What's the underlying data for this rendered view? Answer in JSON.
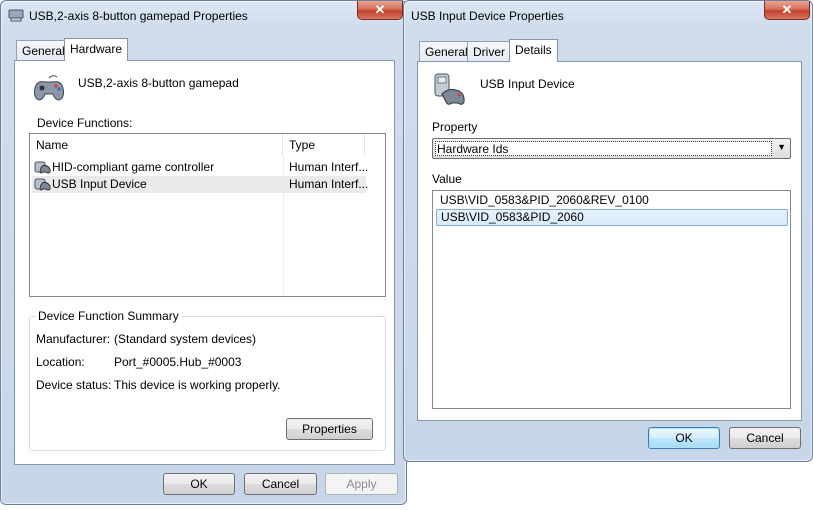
{
  "left_window": {
    "title": "USB,2-axis 8-button gamepad Properties",
    "close_label": "✕",
    "tabs": [
      "General",
      "Hardware"
    ],
    "device_name": "USB,2-axis 8-button gamepad",
    "device_functions_label": "Device Functions:",
    "columns": [
      "Name",
      "Type"
    ],
    "rows": [
      {
        "name": "HID-compliant game controller",
        "type": "Human Interf..."
      },
      {
        "name": "USB Input Device",
        "type": "Human Interf..."
      }
    ],
    "summary_title": "Device Function Summary",
    "manufacturer_label": "Manufacturer:",
    "manufacturer_value": "(Standard system devices)",
    "location_label": "Location:",
    "location_value": "Port_#0005.Hub_#0003",
    "status_label": "Device status:",
    "status_value": "This device is working properly.",
    "properties_button": "Properties",
    "ok_button": "OK",
    "cancel_button": "Cancel",
    "apply_button": "Apply"
  },
  "right_window": {
    "title": "USB Input Device Properties",
    "close_label": "✕",
    "tabs": [
      "General",
      "Driver",
      "Details"
    ],
    "device_name": "USB Input Device",
    "property_label": "Property",
    "property_selected": "Hardware Ids",
    "value_label": "Value",
    "values": [
      "USB\\VID_0583&PID_2060&REV_0100",
      "USB\\VID_0583&PID_2060"
    ],
    "ok_button": "OK",
    "cancel_button": "Cancel"
  }
}
